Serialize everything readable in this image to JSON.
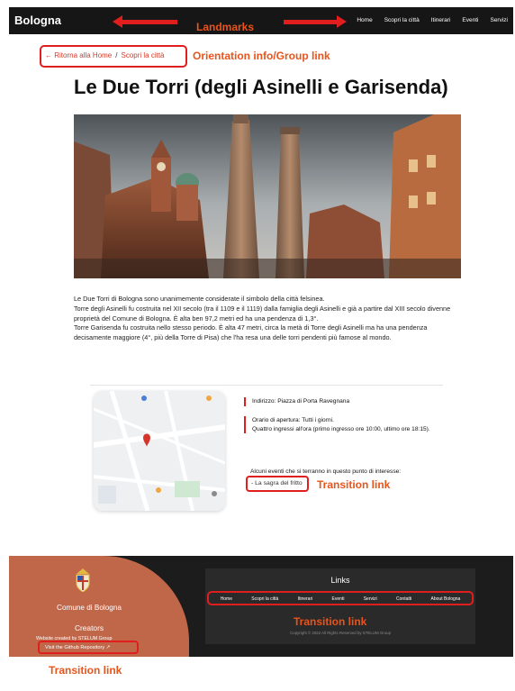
{
  "nav": {
    "brand": "Bologna",
    "items": [
      "Home",
      "Scopri la città",
      "Itinerari",
      "Eventi",
      "Servizi"
    ]
  },
  "annotations": {
    "landmarks": "Landmarks",
    "orientation": "Orientation info/Group link",
    "transition_event": "Transition link",
    "transition_footer": "Transition link",
    "transition_repo": "Transition link",
    "color": "#e8541c"
  },
  "breadcrumb": {
    "back": "← Ritorna alla Home",
    "separator": "/",
    "current": "Scopri la città"
  },
  "page": {
    "title": "Le Due Torri (degli Asinelli e Garisenda)",
    "paragraphs": [
      "Le Due Torri di Bologna sono unanimemente considerate il simbolo della città felsinea.",
      "Torre degli Asinelli fu costruita nel XII secolo (tra il 1109 e il 1119) dalla famiglia degli Asinelli e già a partire dal XIII secolo divenne proprietà del Comune di Bologna. È alta ben 97,2 metri ed ha una pendenza di 1,3°.",
      "Torre Garisenda fu costruita nello stesso periodo. È alta 47 metri, circa la metà di Torre degli Asinelli ma ha una pendenza decisamente maggiore (4°, più della Torre di Pisa) che l'ha resa una delle torri pendenti più famose al mondo."
    ]
  },
  "info": {
    "address": "Indirizzo: Piazza di Porta Ravegnana",
    "hours_line1": "Orario di apertura: Tutti i giorni.",
    "hours_line2": "Quattro ingressi all'ora (primo ingresso ore 10:00, ultimo ore 18:15).",
    "events_label": "Alcuni eventi che si terranno in questo punto di interesse:",
    "event_link": "- La sagra del fritto"
  },
  "footer": {
    "comune": "Comune di Bologna",
    "creators": "Creators",
    "credit": "Website created by STELUM Group",
    "repo_link": "Visit the Github Repository ↗",
    "links_title": "Links",
    "links": [
      "Home",
      "Scopri la città",
      "Itinerari",
      "Eventi",
      "Servizi",
      "Contatti",
      "About Bologna"
    ],
    "copyright": "Copyright © 2022 All Rights Reserved by STELUM Group"
  },
  "colors": {
    "highlight": "#e01e1e",
    "nav_bg": "#161616",
    "footer_bg": "#1c1c1c",
    "footer_brand": "#c0674a"
  }
}
